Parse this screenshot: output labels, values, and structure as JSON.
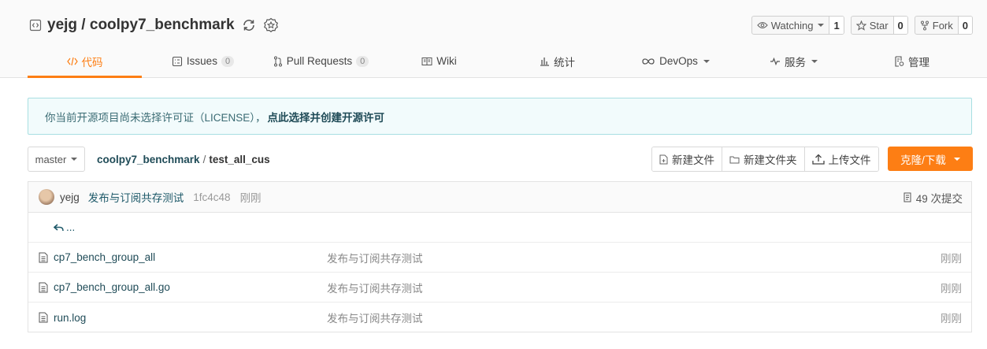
{
  "repo": {
    "owner": "yejg",
    "sep": " / ",
    "name": "coolpy7_benchmark"
  },
  "actions": [
    {
      "label": "Watching",
      "count": "1",
      "icon": "eye-icon"
    },
    {
      "label": "Star",
      "count": "0",
      "icon": "star-icon"
    },
    {
      "label": "Fork",
      "count": "0",
      "icon": "fork-icon"
    }
  ],
  "tabs": [
    {
      "label": "代码",
      "icon": "code-icon",
      "active": true
    },
    {
      "label": "Issues",
      "badge": "0",
      "icon": "issues-icon"
    },
    {
      "label": "Pull Requests",
      "badge": "0",
      "icon": "pull-request-icon"
    },
    {
      "label": "Wiki",
      "icon": "wiki-icon"
    },
    {
      "label": "统计",
      "icon": "stats-icon"
    },
    {
      "label": "DevOps",
      "icon": "devops-icon"
    },
    {
      "label": "服务",
      "icon": "service-icon"
    },
    {
      "label": "管理",
      "icon": "manage-icon"
    }
  ],
  "notice": {
    "text": "你当前开源项目尚未选择许可证（LICENSE），",
    "link": "点此选择并创建开源许可"
  },
  "toolbar": {
    "branch": "master",
    "breadcrumb_repo": "coolpy7_benchmark",
    "breadcrumb_sep": "/",
    "breadcrumb_current": "test_all_cus",
    "new_file": "新建文件",
    "new_folder": "新建文件夹",
    "upload": "上传文件",
    "clone": "克隆/下载"
  },
  "commit": {
    "author": "yejg",
    "message": "发布与订阅共存测试",
    "sha": "1fc4c48",
    "time": "刚刚",
    "count_label": "49 次提交"
  },
  "parent_dir_label": "...",
  "files": [
    {
      "name": "cp7_bench_group_all",
      "message": "发布与订阅共存测试",
      "time": "刚刚"
    },
    {
      "name": "cp7_bench_group_all.go",
      "message": "发布与订阅共存测试",
      "time": "刚刚"
    },
    {
      "name": "run.log",
      "message": "发布与订阅共存测试",
      "time": "刚刚"
    }
  ],
  "colors": {
    "accent": "#fd7e14",
    "link": "#1f4b57",
    "notice_bg": "#f2fbfc"
  }
}
